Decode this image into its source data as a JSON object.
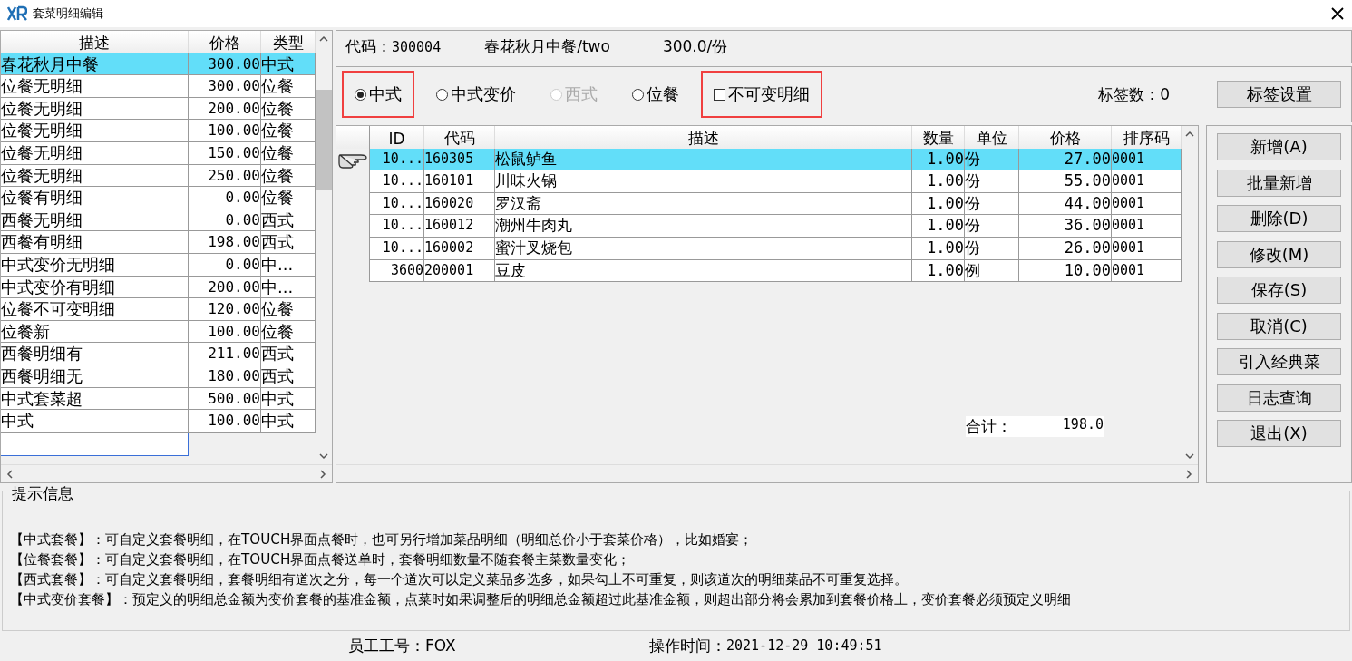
{
  "window": {
    "title": "套菜明细编辑"
  },
  "package_list": {
    "columns": [
      "描述",
      "价格",
      "类型"
    ],
    "rows": [
      {
        "desc": "春花秋月中餐",
        "price": "300.00",
        "type": "中式",
        "selected": true
      },
      {
        "desc": "位餐无明细",
        "price": "300.00",
        "type": "位餐",
        "selected": false
      },
      {
        "desc": "位餐无明细",
        "price": "200.00",
        "type": "位餐",
        "selected": false
      },
      {
        "desc": "位餐无明细",
        "price": "100.00",
        "type": "位餐",
        "selected": false
      },
      {
        "desc": "位餐无明细",
        "price": "150.00",
        "type": "位餐",
        "selected": false
      },
      {
        "desc": "位餐无明细",
        "price": "250.00",
        "type": "位餐",
        "selected": false
      },
      {
        "desc": "位餐有明细",
        "price": "0.00",
        "type": "位餐",
        "selected": false
      },
      {
        "desc": "西餐无明细",
        "price": "0.00",
        "type": "西式",
        "selected": false
      },
      {
        "desc": "西餐有明细",
        "price": "198.00",
        "type": "西式",
        "selected": false
      },
      {
        "desc": "中式变价无明细",
        "price": "0.00",
        "type": "中...",
        "selected": false
      },
      {
        "desc": "中式变价有明细",
        "price": "200.00",
        "type": "中...",
        "selected": false
      },
      {
        "desc": "位餐不可变明细",
        "price": "120.00",
        "type": "位餐",
        "selected": false
      },
      {
        "desc": "位餐新",
        "price": "100.00",
        "type": "位餐",
        "selected": false
      },
      {
        "desc": "西餐明细有",
        "price": "211.00",
        "type": "西式",
        "selected": false
      },
      {
        "desc": "西餐明细无",
        "price": "180.00",
        "type": "西式",
        "selected": false
      },
      {
        "desc": "中式套菜超",
        "price": "500.00",
        "type": "中式",
        "selected": false
      },
      {
        "desc": "中式",
        "price": "100.00",
        "type": "中式",
        "selected": false
      }
    ]
  },
  "header": {
    "code_label": "代码：",
    "code": "300004",
    "name": "春花秋月中餐/two",
    "price": "300.0/份"
  },
  "options": [
    {
      "kind": "radio",
      "label": "中式",
      "selected": true,
      "disabled": false,
      "highlighted": true
    },
    {
      "kind": "radio",
      "label": "中式变价",
      "selected": false,
      "disabled": false,
      "highlighted": false
    },
    {
      "kind": "radio",
      "label": "西式",
      "selected": false,
      "disabled": true,
      "highlighted": false
    },
    {
      "kind": "radio",
      "label": "位餐",
      "selected": false,
      "disabled": false,
      "highlighted": false
    },
    {
      "kind": "checkbox",
      "label": "不可变明细",
      "selected": false,
      "disabled": false,
      "highlighted": true
    }
  ],
  "tag_count": "标签数：0",
  "tag_button": "标签设置",
  "detail_table": {
    "columns": [
      "ID",
      "代码",
      "描述",
      "数量",
      "单位",
      "价格",
      "排序码"
    ],
    "rows": [
      {
        "cells": [
          "10...",
          "160305",
          "松鼠鲈鱼",
          "1.00",
          "份",
          "27.00",
          "0001"
        ],
        "selected": true
      },
      {
        "cells": [
          "10...",
          "160101",
          "川味火锅",
          "1.00",
          "份",
          "55.00",
          "0001"
        ],
        "selected": false
      },
      {
        "cells": [
          "10...",
          "160020",
          "罗汉斋",
          "1.00",
          "份",
          "44.00",
          "0001"
        ],
        "selected": false
      },
      {
        "cells": [
          "10...",
          "160012",
          "潮州牛肉丸",
          "1.00",
          "份",
          "36.00",
          "0001"
        ],
        "selected": false
      },
      {
        "cells": [
          "10...",
          "160002",
          "蜜汁叉烧包",
          "1.00",
          "份",
          "26.00",
          "0001"
        ],
        "selected": false
      },
      {
        "cells": [
          "3600",
          "200001",
          "豆皮",
          "1.00",
          "例",
          "10.00",
          "0001"
        ],
        "selected": false
      }
    ],
    "total_label": "合计：",
    "total": "198.0"
  },
  "buttons": [
    "新增(A)",
    "批量新增",
    "删除(D)",
    "修改(M)",
    "保存(S)",
    "取消(C)",
    "引入经典菜",
    "日志查询",
    "退出(X)"
  ],
  "tips": {
    "title": "提示信息",
    "lines": [
      "【中式套餐】：可自定义套餐明细，在TOUCH界面点餐时，也可另行增加菜品明细（明细总价小于套菜价格），比如婚宴；",
      "【位餐套餐】：可自定义套餐明细，在TOUCH界面点餐送单时，套餐明细数量不随套餐主菜数量变化；",
      "【西式套餐】：可自定义套餐明细，套餐明细有道次之分，每一个道次可以定义菜品多选多，如果勾上不可重复，则该道次的明细菜品不可重复选择。",
      "【中式变价套餐】：预定义的明细总金额为变价套餐的基准金额，点菜时如果调整后的明细总金额超过此基准金额，则超出部分将会累加到套餐价格上，变价套餐必须预定义明细"
    ]
  },
  "status_bar": {
    "employee": "员工工号：FOX",
    "time_label": "操作时间：",
    "time": "2021-12-29 10:49:51"
  }
}
